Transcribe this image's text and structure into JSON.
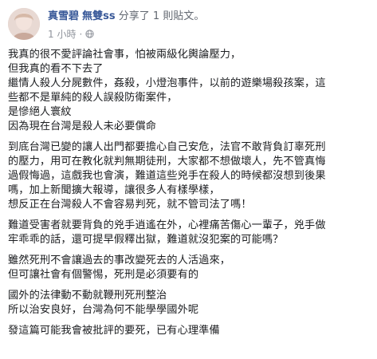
{
  "post": {
    "author": "真雪碧",
    "author_page": "無雙ss",
    "shared_text": "分享了 1 則貼文。",
    "timestamp": "1 小時",
    "separator": "·",
    "privacy_icon": "globe-icon",
    "paragraphs": [
      [
        "我真的很不愛評論社會事，怕被兩級化輿論壓力，",
        "但我真的看不下去了",
        "繼情人殺人分屍數件，姦殺，小燈泡事件，以前的遊樂場殺孩案，這",
        "些都不是單純的殺人誤殺防衛案件，",
        "是慘絕人寰紋",
        "因為現在台灣是殺人未必要償命"
      ],
      [
        "到底台灣已變的讓人出門都要擔心自己安危，法官不敢背負訂辜死刑",
        "的壓力，用可在教化就判無期徒刑，大家都不想做壞人，先不管真悔",
        "過假悔過，這戲我也會演，難道這些兇手在殺人的時候都沒想到後果",
        "嗎，加上新聞擴大報導，讓很多人有樣學樣，",
        "想反正在台灣殺人不會容易判死，就不管司法了嗎！"
      ],
      [
        "難道受害者就要背負的兇手逍遙在外，心裡痛苦傷心一輩子，兇手做",
        "牢乖乖的話，還可提早假釋出獄，難道就沒犯案的可能嗎？"
      ],
      [
        "雖然死刑不會讓過去的事改變死去的人活過來，",
        "但可讓社會有個警惕，死刑是必須要有的"
      ],
      [
        "國外的法律動不動就鞭刑死刑整治",
        "所以治安良好，台灣為何不能學學國外呢"
      ],
      [
        "發這篇可能我會被批評的要死，已有心理準備"
      ]
    ]
  }
}
